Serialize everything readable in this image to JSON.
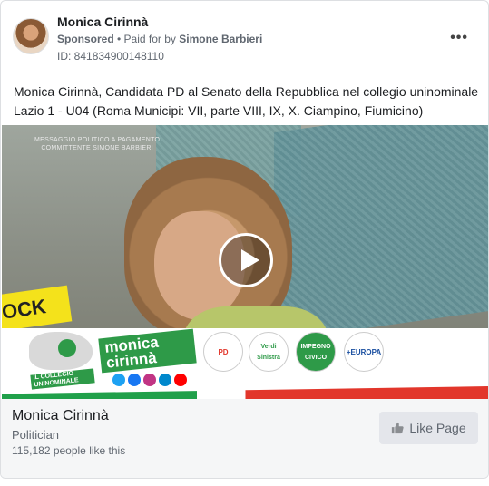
{
  "post": {
    "author": "Monica Cirinnà",
    "sponsored": "Sponsored",
    "paid_prefix": "• Paid for by",
    "payer": "Simone Barbieri",
    "ad_id": "ID: 841834900148110",
    "more_icon": "more-options-icon",
    "caption": "Monica Cirinnà, Candidata PD al Senato della Repubblica nel collegio uninominale Lazio 1 - U04 (Roma Municipi: VII, parte VIII, IX, X. Ciampino, Fiumicino)"
  },
  "media": {
    "disclaimer_line1": "MESSAGGIO POLITICO A PAGAMENTO",
    "disclaimer_line2": "COMMITTENTE SIMONE BARBIERI",
    "sign_text": "OCK",
    "seat_label": "IL COLLEGIO UNINOMINALE SENATO ROMA U04",
    "brand_line1": "monica",
    "brand_line2": "cirinnà",
    "logos": [
      {
        "text": "PD"
      },
      {
        "text": "Verdi Sinistra"
      },
      {
        "text": "IMPEGNO CIVICO"
      },
      {
        "text": "+EUROPA"
      }
    ]
  },
  "footer": {
    "page_name": "Monica Cirinnà",
    "category": "Politician",
    "likes": "115,182 people like this",
    "like_button": "Like Page"
  },
  "colors": {
    "green": "#2e9a48",
    "red": "#e2362b",
    "button_bg": "#e4e6eb"
  }
}
